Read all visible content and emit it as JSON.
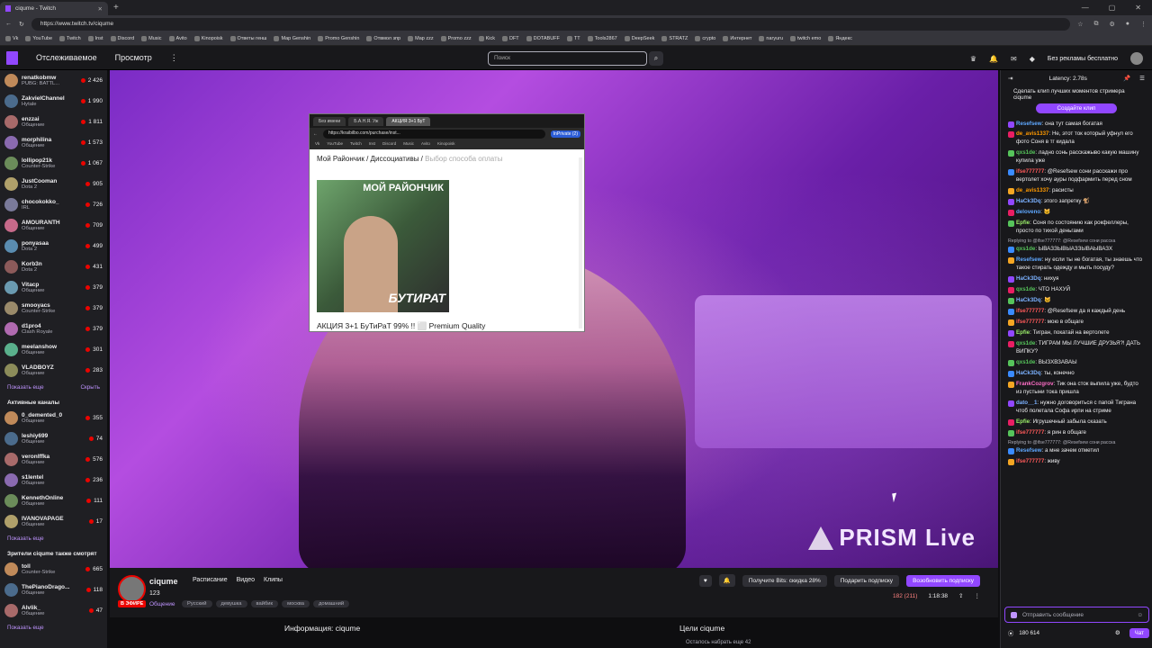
{
  "browser": {
    "tab_title": "ciqume - Twitch",
    "url": "https://www.twitch.tv/ciqume",
    "bookmarks": [
      "Vk",
      "YouTube",
      "Twitch",
      "Inst",
      "Discord",
      "Music",
      "Avito",
      "Kinopoisk",
      "Ответы генш",
      "Map Genshin",
      "Promo Genshin",
      "Отвмол зпр",
      "Map zzz",
      "Promo zzz",
      "Kick",
      "DFT",
      "DOTABUFF",
      "TT",
      "Tools2867",
      "DeepSeek",
      "STRATZ",
      "crypto",
      "Интернет",
      "naryuru",
      "twitch emo",
      "Яндекс"
    ]
  },
  "topnav": {
    "following": "Отслеживаемое",
    "browse": "Просмотр",
    "more": "⋮",
    "search_placeholder": "Поиск",
    "no_ads": "Без рекламы бесплатно"
  },
  "sidebar": {
    "followed": [
      {
        "name": "renatkobmw",
        "game": "PUBG: BATTL...",
        "viewers": "2 426"
      },
      {
        "name": "ZakvielChannel",
        "game": "Hytale",
        "viewers": "1 990"
      },
      {
        "name": "enzzai",
        "game": "Общение",
        "viewers": "1 811"
      },
      {
        "name": "morphilina",
        "game": "Общение",
        "viewers": "1 573"
      },
      {
        "name": "lollipop21k",
        "game": "Counter-Strike",
        "viewers": "1 067"
      },
      {
        "name": "JustCooman",
        "game": "Dota 2",
        "viewers": "905"
      },
      {
        "name": "chocokokko_",
        "game": "IRL",
        "viewers": "726"
      },
      {
        "name": "AMOURANTH",
        "game": "Общение",
        "viewers": "709"
      },
      {
        "name": "ponyasaa",
        "game": "Dota 2",
        "viewers": "499"
      },
      {
        "name": "Korb3n",
        "game": "Dota 2",
        "viewers": "431"
      },
      {
        "name": "Vitacp",
        "game": "Общение",
        "viewers": "379"
      },
      {
        "name": "smooyacs",
        "game": "Counter-Strike",
        "viewers": "379"
      },
      {
        "name": "d1pro4",
        "game": "Clash Royale",
        "viewers": "379"
      },
      {
        "name": "meelanshow",
        "game": "Общение",
        "viewers": "301"
      },
      {
        "name": "VLADBOYZ",
        "game": "Общение",
        "viewers": "283"
      }
    ],
    "show_more": "Показать еще",
    "hide": "Скрыть",
    "active_header": "Активные каналы",
    "active": [
      {
        "name": "0_demented_0",
        "game": "Общение",
        "viewers": "355"
      },
      {
        "name": "leshiy699",
        "game": "Общение",
        "viewers": "74"
      },
      {
        "name": "veronlffka",
        "game": "Общение",
        "viewers": "576"
      },
      {
        "name": "s1lentel",
        "game": "Общение",
        "viewers": "236"
      },
      {
        "name": "KennethOnline",
        "game": "Общение",
        "viewers": "111"
      },
      {
        "name": "IVANOVAPAGE",
        "game": "Общение",
        "viewers": "17"
      }
    ],
    "show_more2": "Показать еще",
    "viewers_header": "Зрители ciqume также смотрят",
    "also": [
      {
        "name": "toll",
        "game": "Counter-Strike",
        "viewers": "665"
      },
      {
        "name": "ThePianoDrago...",
        "game": "Общение",
        "viewers": "118"
      },
      {
        "name": "Alvlik_",
        "game": "Общение",
        "viewers": "47"
      }
    ],
    "show_more3": "Показать еще"
  },
  "overlay": {
    "tabs": [
      "Без имени",
      "Б.А.Н.Я. Уж",
      "АКЦИЯ 3+1 БуТ"
    ],
    "url": "https://kraibilbo.com/purchase/inst...",
    "incognito": "InPrivate (2)",
    "bookmarks": [
      "Vk",
      "YouTube",
      "Twitch",
      "Inst",
      "Discord",
      "Music",
      "Avito",
      "Kinopoisk"
    ],
    "crumb_main": "Мой Райончик / Диссоциативы /",
    "crumb_dim": "Выбор способа оплаты",
    "img_brand": "МОЙ РАЙОНЧИК",
    "img_big": "БУТИРАТ",
    "title": "АКЦИЯ 3+1 БуТиРаТ 99% !! ⬜ Premium Quality"
  },
  "video": {
    "prism": "PRISM Live"
  },
  "stream": {
    "name": "ciqume",
    "tabs": [
      "Расписание",
      "Видео",
      "Клипы"
    ],
    "title": "123",
    "live": "В ЭФИРЕ",
    "category": "Общение",
    "tags": [
      "Русский",
      "девушка",
      "вайбик",
      "москва",
      "домашний"
    ],
    "bits": "Получите Bits: скидка 28%",
    "gift": "Подарить подписку",
    "resub": "Возобновить подписку",
    "viewers": "182 (211)",
    "uptime": "1:18:38"
  },
  "info": {
    "about": "Информация: ciqume",
    "goals": "Цели ciqume",
    "goal_text": "Осталось набрать еще 42"
  },
  "chat": {
    "latency": "Latency: 2.78s",
    "clip_prompt": "Сделать клип лучших моментов стримера ciqume",
    "clip_btn": "Создайте клип",
    "messages": [
      {
        "user": "Resefsew",
        "color": "#5fa8ff",
        "text": "она тут самая богатая"
      },
      {
        "user": "de_avis1337",
        "color": "#ff9a00",
        "text": "Не, этот ток который уфнул его фото Соня в тг кидала"
      },
      {
        "user": "qxs1de",
        "color": "#56c45b",
        "text": "ладно сонь расскажыво какую машину купила уже"
      },
      {
        "user": "ifse777777",
        "color": "#ff5a5a",
        "text": "@Resefsew сони расскажи про вертолет хочу ауры подфармить перед сном"
      },
      {
        "user": "de_avis1337",
        "color": "#ff9a00",
        "text": "расисты"
      },
      {
        "user": "HaCk3Dq",
        "color": "#7bb1ff",
        "text": "этого запретку 🐒"
      },
      {
        "user": "deloveno",
        "color": "#5fa8ff",
        "text": "🐱"
      },
      {
        "user": "Epfie",
        "color": "#9df06a",
        "text": "Соня по состоянию как рокфеллеры, просто по тихой деньгами"
      },
      {
        "user": "qxs1de",
        "color": "#56c45b",
        "text": "ЫВАЗЗЫВЫАЗЗЫВАЫВАЗХ"
      },
      {
        "user": "Resefsew",
        "color": "#5fa8ff",
        "text": "ну если ты не богатая, ты знаешь что такое стирать одежду и мыть посуду?"
      },
      {
        "user": "HaCk3Dq",
        "color": "#7bb1ff",
        "text": "нихуя"
      },
      {
        "user": "qxs1de",
        "color": "#56c45b",
        "text": "ЧТО НАХУЙ"
      },
      {
        "user": "HaCk3Dq",
        "color": "#7bb1ff",
        "text": "🐱"
      },
      {
        "user": "ifse777777",
        "color": "#ff5a5a",
        "text": "@Resefsew да я каждый день"
      },
      {
        "user": "ifse777777",
        "color": "#ff5a5a",
        "text": "мою в общаге"
      },
      {
        "user": "Epfie",
        "color": "#9df06a",
        "text": "Тигран, покатай на вертолете"
      },
      {
        "user": "qxs1de",
        "color": "#56c45b",
        "text": "ТИГРАМ МЫ ЛУЧШИЕ ДРУЗЬЯ?! ДАТЬ ВИПКУ?"
      },
      {
        "user": "qxs1de",
        "color": "#56c45b",
        "text": "ВЫЗХВЗАВАЫ"
      },
      {
        "user": "HaCk3Dq",
        "color": "#7bb1ff",
        "text": "ты, конечно"
      },
      {
        "user": "FrankCozgrov",
        "color": "#ff6ec7",
        "text": "Тик она сток выпила уже, будто из пустыни тока пришла"
      },
      {
        "user": "dato__1",
        "color": "#7bb1ff",
        "text": "нужно договориться с папой Тиграна чтоб полетала Софа ирпи на стриме"
      },
      {
        "user": "Epfie",
        "color": "#9df06a",
        "text": "Игрушечный забыла сказать"
      },
      {
        "user": "ifse777777",
        "color": "#ff5a5a",
        "text": "я рин в общаге"
      },
      {
        "user": "Resefsew",
        "color": "#5fa8ff",
        "text": "а мне зачем отметил"
      },
      {
        "user": "ifse777777",
        "color": "#ff5a5a",
        "text": "живу"
      }
    ],
    "replies": [
      "Replying to @ifse777777: @Resefsew сони расска",
      "Replying to @ifse777777: @Resefsew сони расска"
    ],
    "input_placeholder": "Отправить сообщение",
    "points": "180 614",
    "chat_btn": "Чат"
  }
}
